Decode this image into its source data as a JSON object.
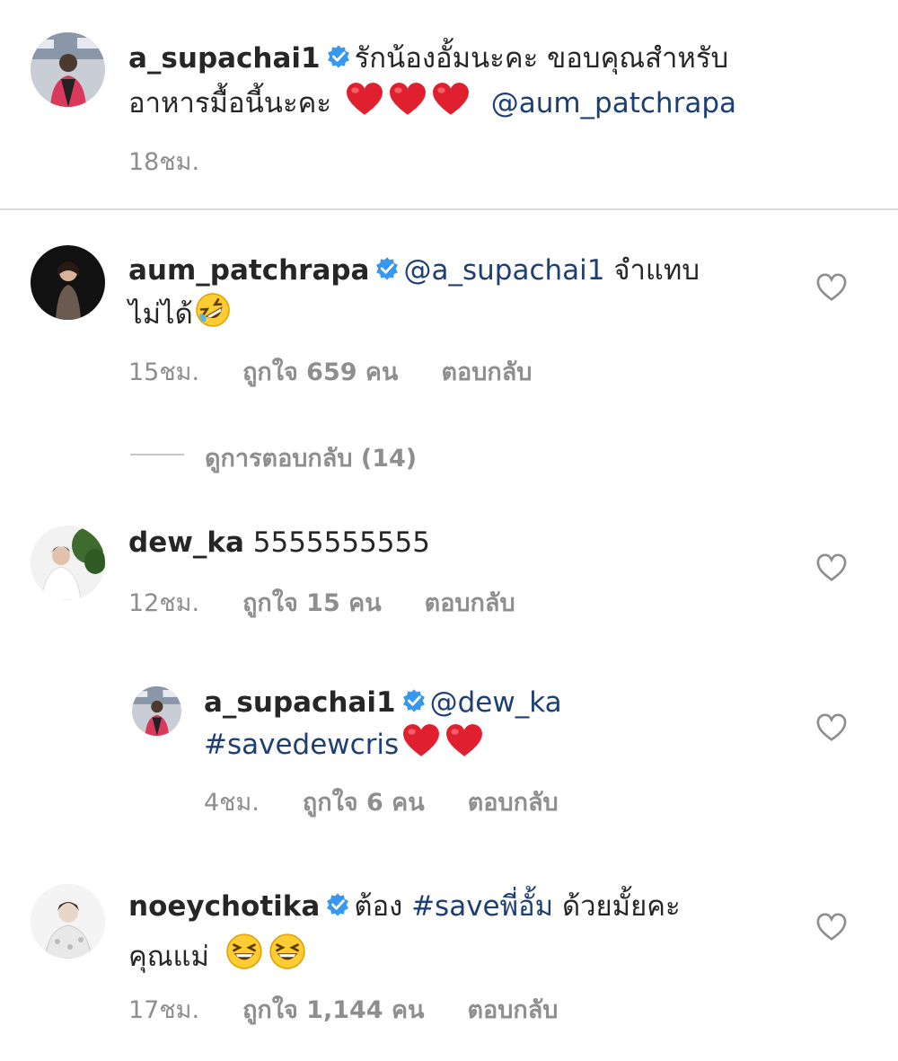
{
  "caption": {
    "username": "a_supachai1",
    "text_line1": "รักน้องอั้มนะคะ ขอบคุณสำหรับ",
    "text_line2": "อาหารมื้อนี้นะคะ",
    "mention": "@aum_patchrapa",
    "time": "18ชม."
  },
  "comments": [
    {
      "username": "aum_patchrapa",
      "mention": "@a_supachai1",
      "text_line1": "จำแทบ",
      "text_line2": "ไม่ได้",
      "time": "15ชม.",
      "likes": "ถูกใจ 659 คน",
      "reply": "ตอบกลับ"
    },
    {
      "username": "dew_ka",
      "text_line1": "5555555555",
      "time": "12ชม.",
      "likes": "ถูกใจ 15 คน",
      "reply": "ตอบกลับ"
    },
    {
      "username": "noeychotika",
      "text_before": "ต้อง",
      "hashtag": "#saveพี่อั้ม",
      "text_after": "ด้วยมั้ยคะ",
      "text_line2": "คุณแม่",
      "time": "17ชม.",
      "likes": "ถูกใจ 1,144 คน",
      "reply": "ตอบกลับ"
    }
  ],
  "view_replies": "ดูการตอบกลับ (14)",
  "nested_reply": {
    "username": "a_supachai1",
    "mention": "@dew_ka",
    "hashtag": "#savedewcris",
    "time": "4ชม.",
    "likes": "ถูกใจ 6 คน",
    "reply": "ตอบกลับ"
  },
  "icons": {
    "verified": "verified-badge-icon",
    "heart": "heart-outline-icon",
    "red_heart": "red-heart-emoji",
    "rofl": "rolling-laughing-emoji",
    "grin": "grinning-squinting-emoji"
  },
  "colors": {
    "link": "#1e3f73",
    "verified": "#3897f0",
    "meta": "#8e8e8e",
    "heart_emoji": "#e0202e"
  }
}
